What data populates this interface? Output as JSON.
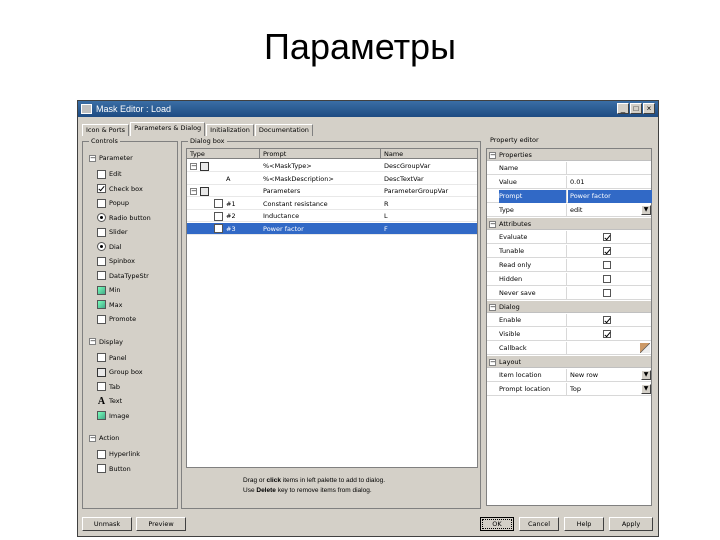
{
  "slide": {
    "title": "Параметры"
  },
  "window": {
    "title": "Mask Editor : Load",
    "buttons": {
      "minimize": "_",
      "maximize": "□",
      "close": "×"
    }
  },
  "tabs": [
    {
      "label": "Icon & Ports",
      "active": false
    },
    {
      "label": "Parameters & Dialog",
      "active": true
    },
    {
      "label": "Initialization",
      "active": false
    },
    {
      "label": "Documentation",
      "active": false
    }
  ],
  "controls": {
    "title": "Controls",
    "parameter_group": "Parameter",
    "parameter_items": [
      {
        "label": "Edit",
        "icon": "edit-icon"
      },
      {
        "label": "Check box",
        "icon": "checkbox-icon"
      },
      {
        "label": "Popup",
        "icon": "popup-icon"
      },
      {
        "label": "Radio button",
        "icon": "radio-icon"
      },
      {
        "label": "Slider",
        "icon": "slider-icon"
      },
      {
        "label": "Dial",
        "icon": "dial-icon"
      },
      {
        "label": "Spinbox",
        "icon": "spinbox-icon"
      },
      {
        "label": "DataTypeStr",
        "icon": "datatype-icon"
      },
      {
        "label": "Min",
        "icon": "min-icon"
      },
      {
        "label": "Max",
        "icon": "max-icon"
      },
      {
        "label": "Promote",
        "icon": "promote-icon"
      }
    ],
    "display_group": "Display",
    "display_items": [
      {
        "label": "Panel",
        "icon": "panel-icon"
      },
      {
        "label": "Group box",
        "icon": "groupbox-icon"
      },
      {
        "label": "Tab",
        "icon": "tab-icon"
      },
      {
        "label": "Text",
        "icon": "text-icon"
      },
      {
        "label": "Image",
        "icon": "image-icon"
      }
    ],
    "action_group": "Action",
    "action_items": [
      {
        "label": "Hyperlink",
        "icon": "hyperlink-icon"
      },
      {
        "label": "Button",
        "icon": "button-icon"
      }
    ]
  },
  "dialog_box": {
    "title": "Dialog box",
    "columns": [
      "Type",
      "Prompt",
      "Name"
    ],
    "rows": [
      {
        "type_icon": "groupbox-icon",
        "type": "",
        "prompt": "%<MaskType>",
        "name": "DescGroupVar",
        "indent": 0,
        "selected": false
      },
      {
        "type_icon": "text-icon",
        "type": "A",
        "prompt": "%<MaskDescription>",
        "name": "DescTextVar",
        "indent": 1,
        "selected": false
      },
      {
        "type_icon": "groupbox-icon",
        "type": "",
        "prompt": "Parameters",
        "name": "ParameterGroupVar",
        "indent": 0,
        "selected": false
      },
      {
        "type_icon": "edit-icon",
        "type": "#1",
        "prompt": "Constant resistance",
        "name": "R",
        "indent": 1,
        "selected": false
      },
      {
        "type_icon": "edit-icon",
        "type": "#2",
        "prompt": "Inductance",
        "name": "L",
        "indent": 1,
        "selected": false
      },
      {
        "type_icon": "edit-icon",
        "type": "#3",
        "prompt": "Power factor",
        "name": "F",
        "indent": 1,
        "selected": true
      }
    ],
    "hint_line1_pre": "Drag or ",
    "hint_line1_bold": "click",
    "hint_line1_post": " items in left palette to add to dialog.",
    "hint_line2_pre": "Use ",
    "hint_line2_bold": "Delete",
    "hint_line2_post": " key to remove items from dialog."
  },
  "property_editor": {
    "title": "Property editor",
    "sections": [
      {
        "label": "Properties",
        "rows": [
          {
            "name": "Name",
            "value": "",
            "kind": "text"
          },
          {
            "name": "Value",
            "value": "0.01",
            "kind": "text"
          },
          {
            "name": "Prompt",
            "value": "Power factor",
            "kind": "text",
            "selected": true
          },
          {
            "name": "Type",
            "value": "edit",
            "kind": "dropdown"
          }
        ]
      },
      {
        "label": "Attributes",
        "rows": [
          {
            "name": "Evaluate",
            "checked": true,
            "kind": "check"
          },
          {
            "name": "Tunable",
            "checked": true,
            "kind": "check"
          },
          {
            "name": "Read only",
            "checked": false,
            "kind": "check"
          },
          {
            "name": "Hidden",
            "checked": false,
            "kind": "check"
          },
          {
            "name": "Never save",
            "checked": false,
            "kind": "check"
          }
        ]
      },
      {
        "label": "Dialog",
        "rows": [
          {
            "name": "Enable",
            "checked": true,
            "kind": "check"
          },
          {
            "name": "Visible",
            "checked": true,
            "kind": "check"
          },
          {
            "name": "Callback",
            "value": "",
            "kind": "pencil"
          }
        ]
      },
      {
        "label": "Layout",
        "rows": [
          {
            "name": "Item location",
            "value": "New row",
            "kind": "dropdown"
          },
          {
            "name": "Prompt location",
            "value": "Top",
            "kind": "dropdown"
          }
        ]
      }
    ]
  },
  "footer": {
    "unmask": "Unmask",
    "preview": "Preview",
    "ok": "OK",
    "cancel": "Cancel",
    "help": "Help",
    "apply": "Apply"
  }
}
